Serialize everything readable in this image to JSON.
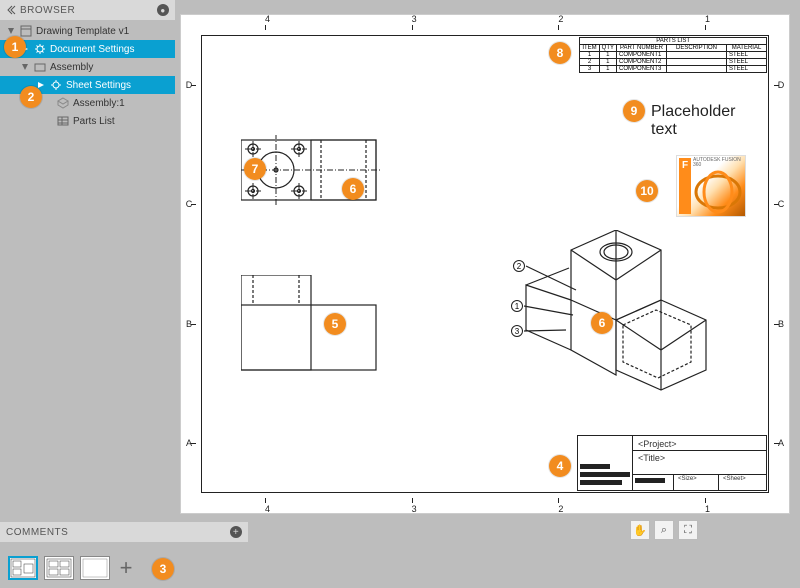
{
  "browser": {
    "title": "BROWSER",
    "items": {
      "template": "Drawing Template v1",
      "docSettings": "Document Settings",
      "assembly": "Assembly",
      "sheetSettings": "Sheet Settings",
      "assembly1": "Assembly:1",
      "partsList": "Parts List"
    }
  },
  "comments": {
    "title": "COMMENTS"
  },
  "ruler": {
    "cols": [
      "4",
      "3",
      "2",
      "1"
    ],
    "rows": [
      "D",
      "C",
      "B",
      "A"
    ]
  },
  "partsList": {
    "heading": "PARTS LIST",
    "headers": [
      "ITEM",
      "QTY",
      "PART NUMBER",
      "DESCRIPTION",
      "MATERIAL"
    ],
    "rows": [
      [
        "1",
        "1",
        "COMPONENT1",
        "",
        "STEEL"
      ],
      [
        "2",
        "1",
        "COMPONENT2",
        "",
        "STEEL"
      ],
      [
        "3",
        "1",
        "COMPONENT3",
        "",
        "STEEL"
      ]
    ]
  },
  "placeholder": {
    "line1": "Placeholder",
    "line2": "text"
  },
  "productBox": {
    "brand": "F",
    "name": "AUTODESK FUSION 360"
  },
  "titleBlock": {
    "project": "<Project>",
    "title": "<Title>",
    "size": "<Size>",
    "sheet": "<Sheet>"
  },
  "isoBalloons": [
    "2",
    "1",
    "3"
  ],
  "callouts": [
    "1",
    "2",
    "3",
    "4",
    "5",
    "6",
    "7",
    "8",
    "9",
    "10"
  ],
  "nav": {
    "pan": "✋",
    "zoomWindow": "⌕",
    "zoomFit": "⛶"
  }
}
